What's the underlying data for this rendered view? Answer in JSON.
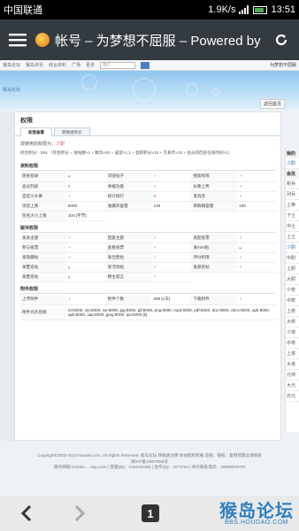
{
  "status_bar": {
    "carrier": "中国联通",
    "speed": "1.9K/s",
    "time": "13:51"
  },
  "browser": {
    "page_title": "帐号 – 为梦想不屈服 – Powered by p",
    "tab_count": "1"
  },
  "site_nav": {
    "items": [
      "猴岛论坛",
      "猴岛资讯",
      "综合资料",
      "广场",
      "更多"
    ],
    "search_placeholder": "用户",
    "user": "为梦想不屈服"
  },
  "banner": {
    "text": "猴岛论坛",
    "back_label": "返回首页"
  },
  "panel": {
    "title": "权限",
    "tabs": [
      {
        "label": "权限查看",
        "active": true
      },
      {
        "label": "转换组购买",
        "active": false
      }
    ],
    "usergroup_label": "现使用的权限为：",
    "usergroup_value": "少尉",
    "credits_text": "综合积分：584 （综合积分 = 发帖数×1 + 精华×50 + 威望×1.2 + 鼠积积分×10 + 交易币×10 + 会员的历史在线时间×1）"
  },
  "sections": {
    "basic": {
      "title": "资料权限",
      "rows": [
        [
          {
            "label": "隐身登录",
            "value": "no"
          },
          {
            "label": "浏览帖子",
            "value": "yes"
          },
          {
            "label": "搜索权限",
            "value": "yes"
          }
        ],
        [
          {
            "label": "会员列表",
            "value": "no"
          },
          {
            "label": "举报功能",
            "value": "yes"
          },
          {
            "label": "头像上传",
            "value": "yes"
          }
        ],
        [
          {
            "label": "自定义头像",
            "value": "yes"
          },
          {
            "label": "统计排行",
            "value": "no"
          },
          {
            "label": "发消息",
            "value": "yes"
          }
        ],
        [
          {
            "label": "消息上限",
            "value": "5000"
          },
          {
            "label": "收藏夹容量",
            "value": "120"
          },
          {
            "label": "草稿箱容量",
            "value": "100"
          }
        ],
        [
          {
            "label": "签名大小上限",
            "value": "100 [字节]"
          }
        ]
      ]
    },
    "forum": {
      "title": "版块权限",
      "rows": [
        [
          {
            "label": "发表主题",
            "value": "yes"
          },
          {
            "label": "回复主题",
            "value": "yes"
          },
          {
            "label": "发起投票",
            "value": "yes"
          }
        ],
        [
          {
            "label": "参与投票",
            "value": "yes"
          },
          {
            "label": "查看投票",
            "value": "yes"
          },
          {
            "label": "发html帖",
            "value": "no"
          }
        ],
        [
          {
            "label": "发隐藏帖",
            "value": "yes"
          },
          {
            "label": "发出售帖",
            "value": "yes"
          },
          {
            "label": "评分权限",
            "value": "yes"
          }
        ],
        [
          {
            "label": "发匿名帖",
            "value": "no"
          },
          {
            "label": "发活动帖",
            "value": "yes"
          },
          {
            "label": "发悬赏帖",
            "value": "yes"
          }
        ],
        [
          {
            "label": "发匿名帖",
            "value": "no"
          },
          {
            "label": "楼主留言",
            "value": "yes"
          }
        ]
      ]
    },
    "attach": {
      "title": "附件权限",
      "rows": [
        [
          {
            "label": "上传附件",
            "value": "yes"
          },
          {
            "label": "附件个数",
            "value": "300 [1天]"
          },
          {
            "label": "下载附件",
            "value": "yes"
          }
        ]
      ],
      "ext_label": "附件允许后缀",
      "ext_value": "txt:8000, zip:8000, rar:8000, jpg:8000, gif:8000, png:8000, mp3:8000, pdf:8000, doc:8000, docx:8000, apk:8000, apk:8000, xap:8000, jpeg:8000, ipa:8000 [k]"
    }
  },
  "sidebar": {
    "title": "我的",
    "current": "少尉",
    "group_title": "会员",
    "items": [
      "新兵",
      "列兵",
      "上等",
      "下士",
      "中士",
      "上士",
      "少尉",
      "中尉",
      "上尉",
      "大尉",
      "少校",
      "中校",
      "上校",
      "大校",
      "少将",
      "中将",
      "上将",
      "大将",
      "元帅",
      "大元",
      "共元"
    ]
  },
  "footer": {
    "line1": "Copyright©2002-2013 houdao.com, All Rights Reserved. 猴岛论坛 转载请注明 本站授权转载 违规、侵权、复制或建议请联系",
    "line2": "闽ICP备13007556号",
    "line3": "服务邮箱:houdao.... sigu.com | 客服QQ：1194152186 | 合作QQ：1071764 | 商务联系电话：18608038758"
  },
  "watermark": {
    "main": "猴岛论坛",
    "sub": "BBS.HOUDAO.COM"
  },
  "colors": {
    "browser_bar": "#333a40",
    "accent": "#2d7fc1",
    "yes": "#3aa03a",
    "no": "#e04040"
  }
}
